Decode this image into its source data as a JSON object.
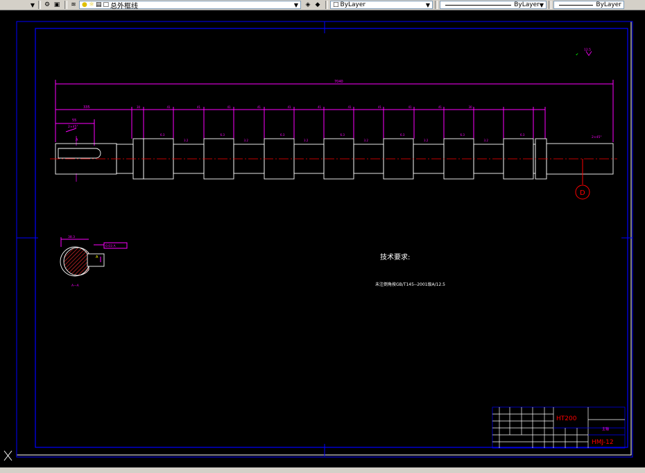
{
  "toolbar": {
    "layer_name": "总外框线",
    "color_value": "ByLayer",
    "linetype_value": "ByLayer",
    "lineweight_value": "ByLayer"
  },
  "drawing": {
    "overall_length": "7040",
    "first_segment": "335",
    "keyway_length": "55",
    "chamfer": "2×45°",
    "end_chamfer": "2×45°",
    "section_label": "D",
    "tech_req_title": "技术要求:",
    "tech_req_line": "未注倒角按GB/T145--2001级A/12.5",
    "section_caption": "A—A",
    "section_dim": "38.3",
    "section_tol": "0.03 A",
    "roughness": "12.5",
    "spacing_dims": [
      "30",
      "41",
      "41",
      "41",
      "41",
      "41",
      "41",
      "41",
      "41",
      "41",
      "41",
      "30"
    ],
    "roughness_marks": [
      "6.3",
      "6.3",
      "6.3",
      "6.3",
      "6.3",
      "6.3",
      "6.3",
      "6.3",
      "6.3",
      "6.3",
      "6.3",
      "6.3"
    ],
    "small_marks": [
      "3.2",
      "3.2",
      "3.2",
      "3.2",
      "3.2",
      "3.2",
      "3.2",
      "3.2",
      "3.2",
      "3.2",
      "3.2"
    ]
  },
  "title_block": {
    "material": "HT200",
    "part_name": "主轴",
    "drawing_no": "HMJ-12"
  },
  "colors": {
    "border": "#0000ff",
    "dimension": "#ff00ff",
    "object": "#ffffff",
    "centerline": "#ff0000",
    "text_red": "#ff0000"
  }
}
